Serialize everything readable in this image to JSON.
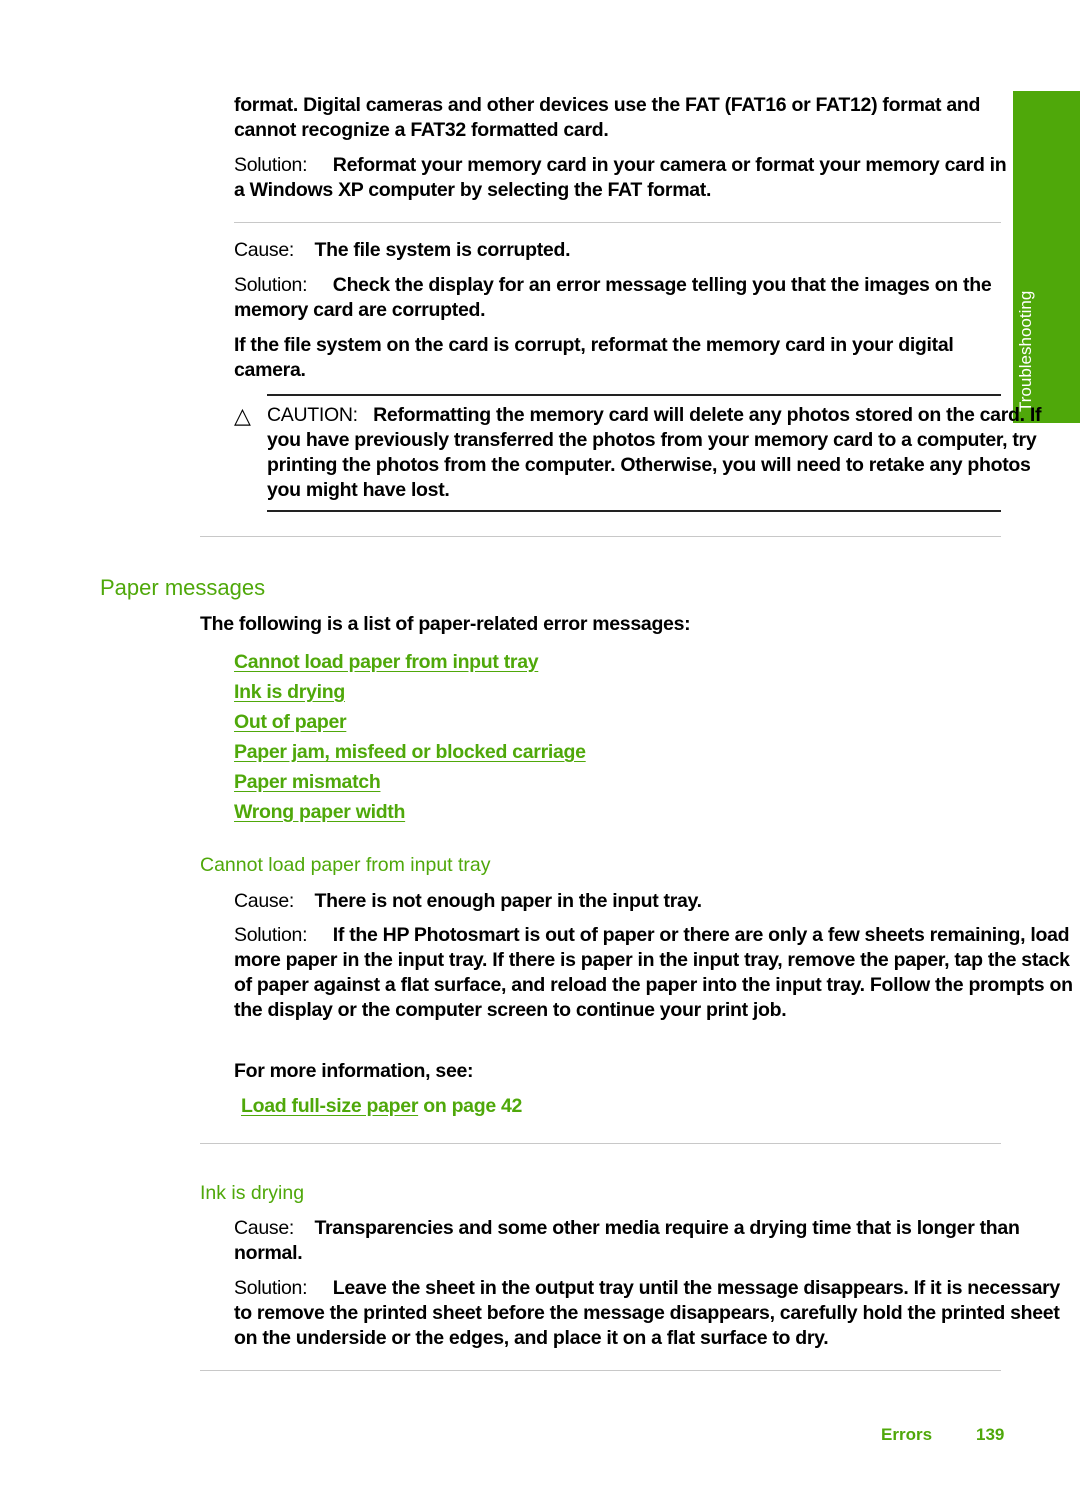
{
  "side_tab": {
    "label": "Troubleshooting",
    "color": "#4fa80a"
  },
  "top": {
    "continued_line1": "format. Digital cameras and other devices use the FAT (FAT16 or FAT12) format and",
    "continued_line2": "cannot recognize a FAT32 formatted card.",
    "solution_label": "Solution:",
    "solution_text": "Reformat your memory card in your camera or format your memory card in a Windows XP computer by selecting the FAT format."
  },
  "corrupt": {
    "cause_label": "Cause:",
    "cause_text": "The file system is corrupted.",
    "solution_label": "Solution:",
    "solution_text": "Check the display for an error message telling you that the images on the memory card are corrupted.",
    "extra_text": "If the file system on the card is corrupt, reformat the memory card in your digital camera.",
    "caution_label": "CAUTION:",
    "caution_text": "Reformatting the memory card will delete any photos stored on the card. If you have previously transferred the photos from your memory card to a computer, try printing the photos from the computer. Otherwise, you will need to retake any photos you might have lost."
  },
  "paper_messages": {
    "heading": "Paper messages",
    "intro": "The following is a list of paper-related error messages:",
    "links": [
      "Cannot load paper from input tray",
      "Ink is drying",
      "Out of paper",
      "Paper jam, misfeed or blocked carriage",
      "Paper mismatch",
      "Wrong paper width"
    ]
  },
  "cannot_load": {
    "heading": "Cannot load paper from input tray",
    "cause_label": "Cause:",
    "cause_text": "There is not enough paper in the input tray.",
    "solution_label": "Solution:",
    "solution_text": "If the HP Photosmart is out of paper or there are only a few sheets remaining, load more paper in the input tray. If there is paper in the input tray, remove the paper, tap the stack of paper against a flat surface, and reload the paper into the input tray. Follow the prompts on the display or the computer screen to continue your print job.",
    "more_info": "For more information, see:",
    "ref_link": "Load full-size paper",
    "ref_page": " on page 42"
  },
  "ink_drying": {
    "heading": "Ink is drying",
    "cause_label": "Cause:",
    "cause_text": "Transparencies and some other media require a drying time that is longer than normal.",
    "solution_label": "Solution:",
    "solution_text": "Leave the sheet in the output tray until the message disappears. If it is necessary to remove the printed sheet before the message disappears, carefully hold the printed sheet on the underside or the edges, and place it on a flat surface to dry."
  },
  "footer": {
    "section": "Errors",
    "page_number": "139"
  }
}
